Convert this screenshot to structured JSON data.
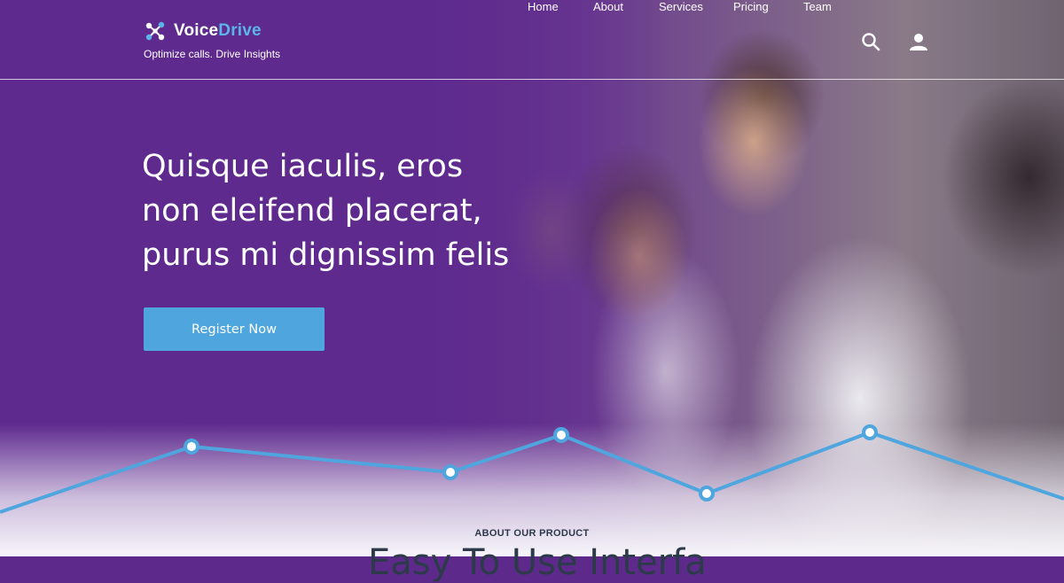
{
  "brand": {
    "name_part1": "Voice",
    "name_part2": "Drive",
    "tagline": "Optimize calls. Drive Insights",
    "logo_icon": "molecule-icon",
    "accent_color": "#5cb5ea"
  },
  "nav": {
    "items": [
      {
        "label": "Home"
      },
      {
        "label": "About"
      },
      {
        "label": "Services"
      },
      {
        "label": "Pricing"
      },
      {
        "label": "Team"
      }
    ],
    "search_icon": "search-icon",
    "user_icon": "user-icon"
  },
  "hero": {
    "headline_line1": "Quisque iaculis, eros",
    "headline_line2": "non eleifend placerat,",
    "headline_line3": "purus mi dignissim felis",
    "cta_label": "Register Now",
    "cta_color": "#4fa6df",
    "background_color": "#5e2a8e"
  },
  "about": {
    "eyebrow": "ABOUT OUR PRODUCT",
    "title_partial": "Easy To Use Interfa"
  },
  "colors": {
    "line": "#4fa6df",
    "text_dark": "#2d3a4a"
  }
}
